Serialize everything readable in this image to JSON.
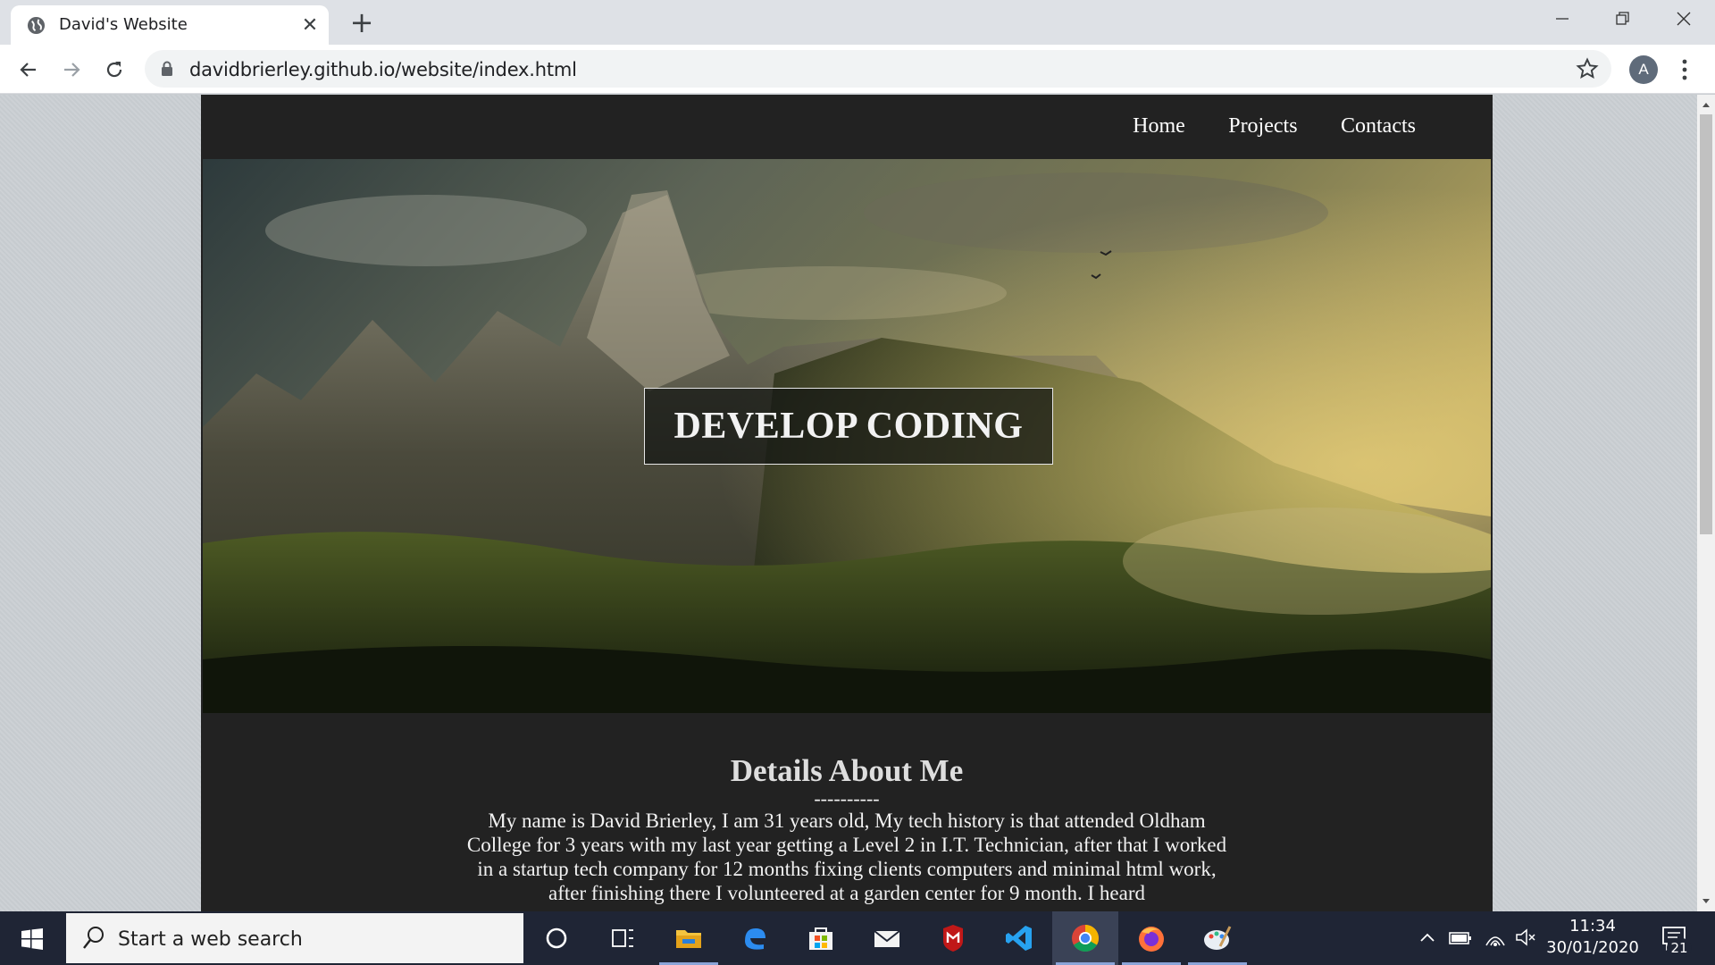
{
  "browser": {
    "tab_title": "David's Website",
    "close_tab_glyph": "✕",
    "new_tab_glyph": "+",
    "url": "davidbrierley.github.io/website/index.html",
    "profile_initial": "A"
  },
  "site": {
    "nav": [
      "Home",
      "Projects",
      "Contacts"
    ],
    "hero_title": "DEVELOP CODING",
    "about_title": "Details About Me",
    "about_separator": "----------",
    "about_text": "My name is David Brierley, I am 31 years old, My tech history is that attended Oldham College for 3 years with my last year getting a Level 2 in I.T. Technician, after that I worked in a startup tech company for 12 months fixing clients computers and minimal html work, after finishing there I volunteered at a garden center for 9 month. I heard"
  },
  "taskbar": {
    "search_placeholder": "Start a web search",
    "apps": [
      "cortana-icon",
      "task-view-icon",
      "file-explorer-icon",
      "edge-icon",
      "store-icon",
      "mail-icon",
      "mcafee-icon",
      "vscode-icon",
      "chrome-icon",
      "firefox-icon",
      "paint-icon"
    ],
    "time": "11:34",
    "date": "30/01/2020",
    "notification_count": "21"
  },
  "colors": {
    "site_bg": "#222222",
    "taskbar_bg": "#1f2535",
    "tab_strip": "#dee1e6"
  }
}
